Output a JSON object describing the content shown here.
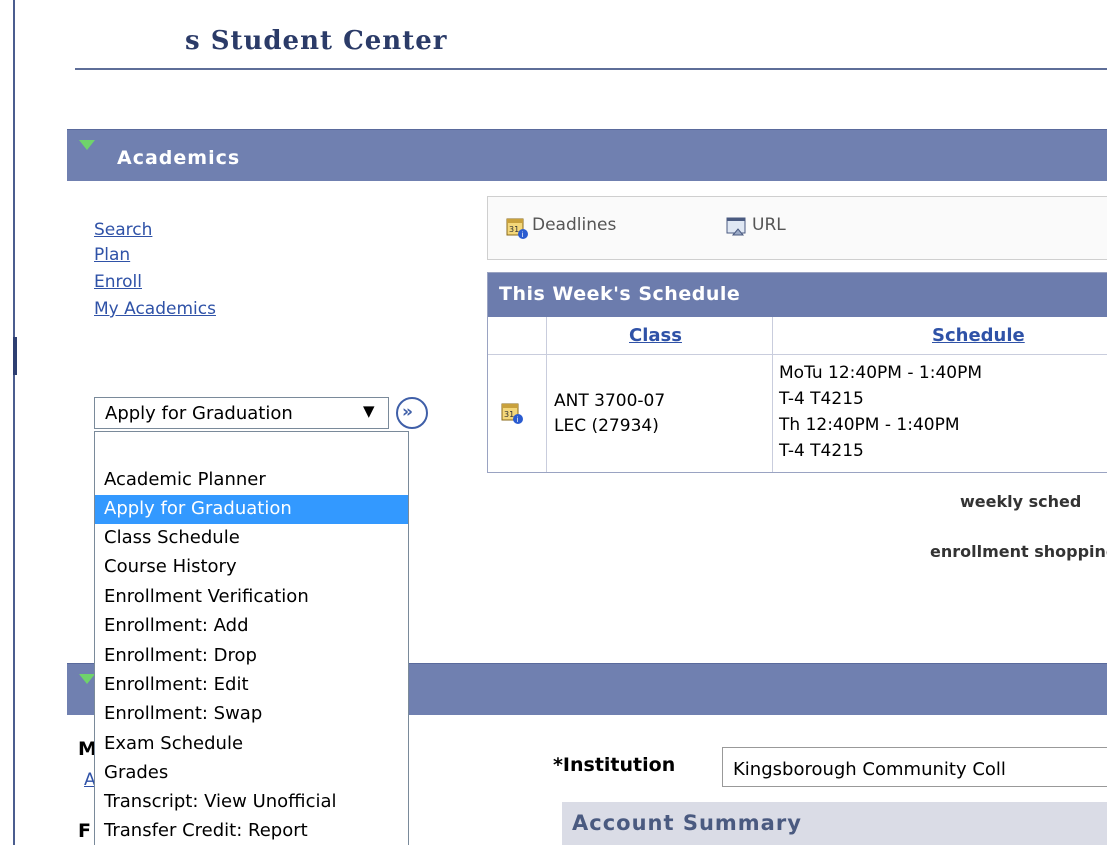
{
  "page": {
    "title": "s Student Center"
  },
  "academics": {
    "title": "Academics",
    "links": [
      "Search",
      "Plan",
      "Enroll",
      "My Academics"
    ],
    "toolbar": {
      "deadlines": "Deadlines",
      "url": "URL"
    },
    "schedule": {
      "title": "This Week's Schedule",
      "columns": [
        "Class",
        "Schedule"
      ],
      "rows": [
        {
          "class": [
            "ANT 3700-07",
            "LEC (27934)"
          ],
          "schedule": [
            "MoTu 12:40PM - 1:40PM",
            "T-4 T4215",
            "Th 12:40PM - 1:40PM",
            "T-4 T4215"
          ]
        }
      ]
    },
    "weekly_link": "weekly sched",
    "shopping_link": "enrollment shopping",
    "dropdown": {
      "selected": "Apply for Graduation",
      "arrow": "▼",
      "go": "»",
      "options": [
        "",
        "Academic Planner",
        "Apply for Graduation",
        "Class Schedule",
        "Course History",
        "Enrollment Verification",
        "Enrollment: Add",
        "Enrollment: Drop",
        "Enrollment: Edit",
        "Enrollment: Swap",
        "Exam Schedule",
        "Grades",
        "Transcript: View Unofficial",
        "Transfer Credit: Report"
      ]
    }
  },
  "finances": {
    "left_letters": [
      "M",
      "A",
      "F"
    ],
    "institution_label": "*Institution",
    "institution_value": "Kingsborough Community Coll",
    "account_summary": "Account Summary"
  }
}
